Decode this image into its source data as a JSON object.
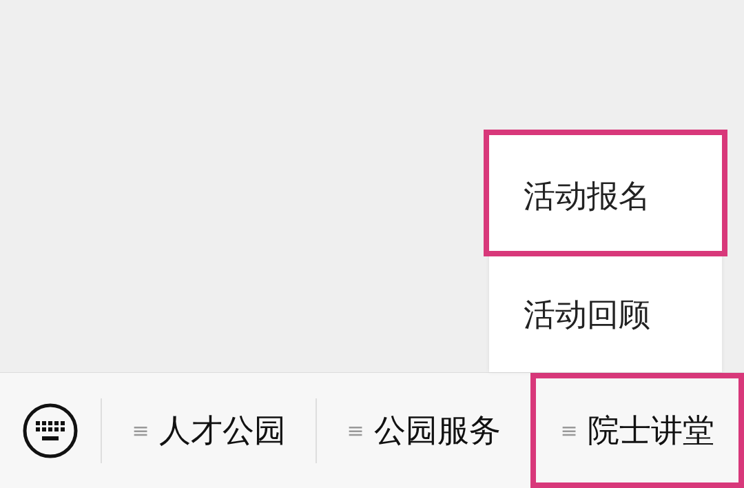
{
  "popup_menu": {
    "items": [
      {
        "label": "活动报名",
        "highlighted": true
      },
      {
        "label": "活动回顾",
        "highlighted": false
      }
    ]
  },
  "menu_bar": {
    "tabs": [
      {
        "handle": "≡",
        "label": "人才公园",
        "highlighted": false
      },
      {
        "handle": "≡",
        "label": "公园服务",
        "highlighted": false
      },
      {
        "handle": "≡",
        "label": "院士讲堂",
        "highlighted": true
      }
    ]
  }
}
